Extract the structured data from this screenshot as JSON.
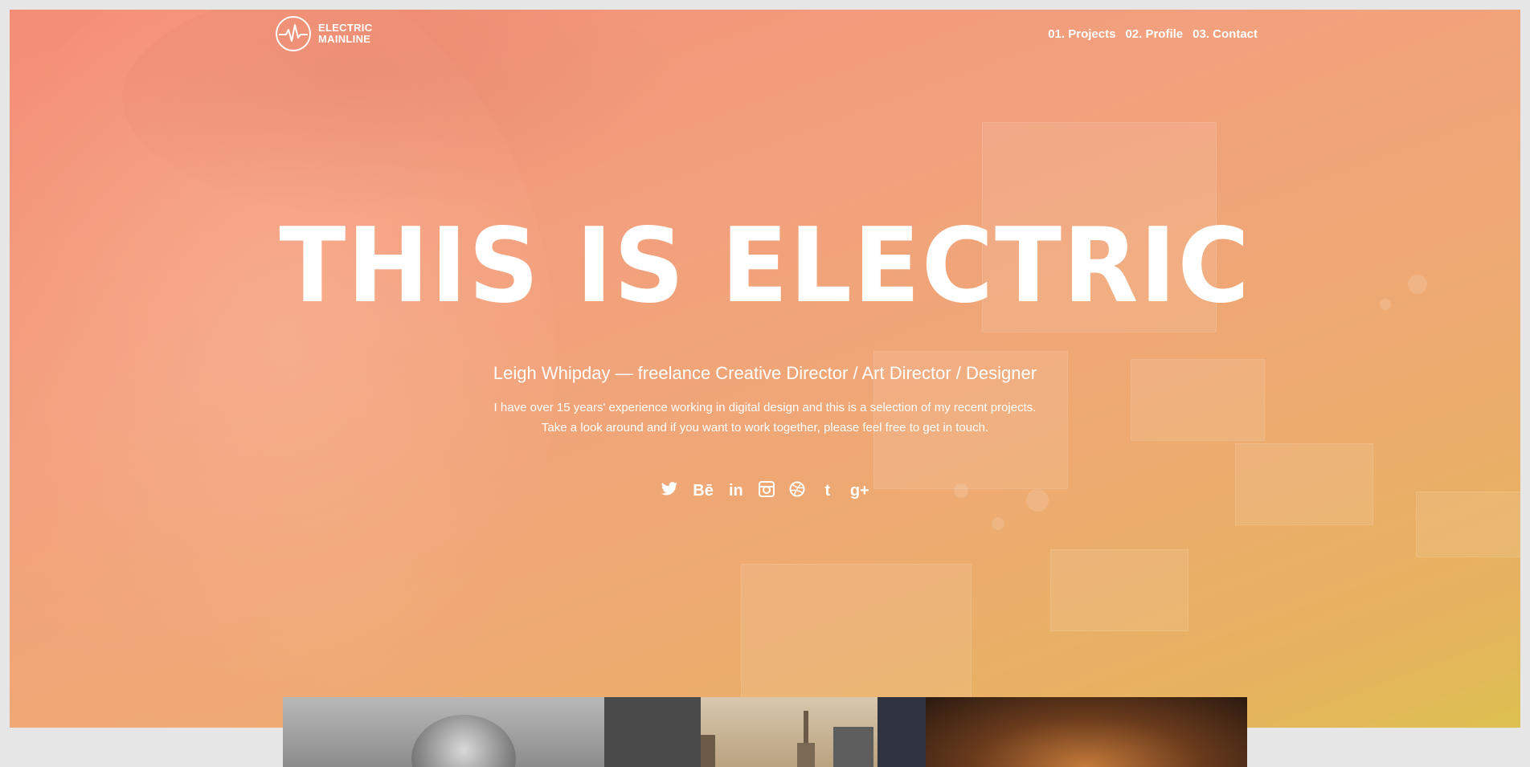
{
  "logo": {
    "line1": "ELECTRIC",
    "line2": "MAINLINE",
    "icon": "pulse-circle-icon"
  },
  "nav": [
    {
      "label": "01. Projects"
    },
    {
      "label": "02. Profile"
    },
    {
      "label": "03. Contact"
    }
  ],
  "hero": {
    "headline": "THIS IS ELECTRIC",
    "tagline": "Leigh Whipday — freelance Creative Director / Art Director / Designer",
    "intro_line1": "I have over 15 years' experience working in digital design and this is a selection of my recent projects.",
    "intro_line2": "Take a look around and if you want to work together, please feel free to get in touch."
  },
  "social": [
    {
      "name": "twitter-icon",
      "glyph": ""
    },
    {
      "name": "behance-icon",
      "glyph": "Bē"
    },
    {
      "name": "linkedin-icon",
      "glyph": "in"
    },
    {
      "name": "instagram-icon",
      "glyph": ""
    },
    {
      "name": "dribbble-icon",
      "glyph": ""
    },
    {
      "name": "tumblr-icon",
      "glyph": "t"
    },
    {
      "name": "google-plus-icon",
      "glyph": "g+"
    }
  ],
  "colors": {
    "page_bg": "#e6e6e6",
    "gradient_start": "#f48d76",
    "gradient_end": "#dcc150",
    "text": "#ffffff"
  }
}
